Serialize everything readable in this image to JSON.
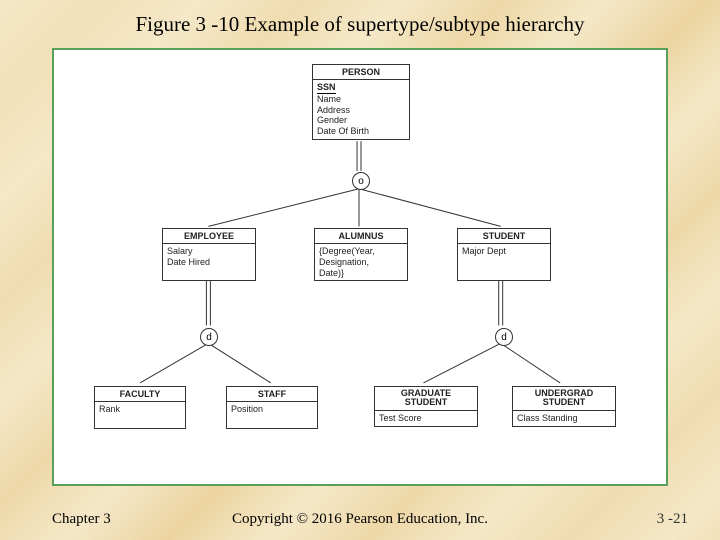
{
  "title": "Figure 3 -10 Example of supertype/subtype hierarchy",
  "footer": {
    "chapter": "Chapter 3",
    "copyright": "Copyright © 2016 Pearson Education, Inc.",
    "page": "3 -21"
  },
  "constraints": {
    "top": "o",
    "leftD": "d",
    "rightD": "d"
  },
  "entities": {
    "person": {
      "name": "PERSON",
      "key": "SSN",
      "attrs": [
        "Name",
        "Address",
        "Gender",
        "Date Of Birth"
      ]
    },
    "employee": {
      "name": "EMPLOYEE",
      "attrs": [
        "Salary",
        "Date Hired"
      ]
    },
    "alumnus": {
      "name": "ALUMNUS",
      "attrs": [
        "{Degree(Year,",
        "Designation,",
        "Date)}"
      ]
    },
    "student": {
      "name": "STUDENT",
      "attrs": [
        "Major Dept"
      ]
    },
    "faculty": {
      "name": "FACULTY",
      "attrs": [
        "Rank"
      ]
    },
    "staff": {
      "name": "STAFF",
      "attrs": [
        "Position"
      ]
    },
    "grad": {
      "name": "GRADUATE STUDENT",
      "attrs": [
        "Test Score"
      ]
    },
    "ugrad": {
      "name": "UNDERGRAD STUDENT",
      "attrs": [
        "Class Standing"
      ]
    }
  }
}
